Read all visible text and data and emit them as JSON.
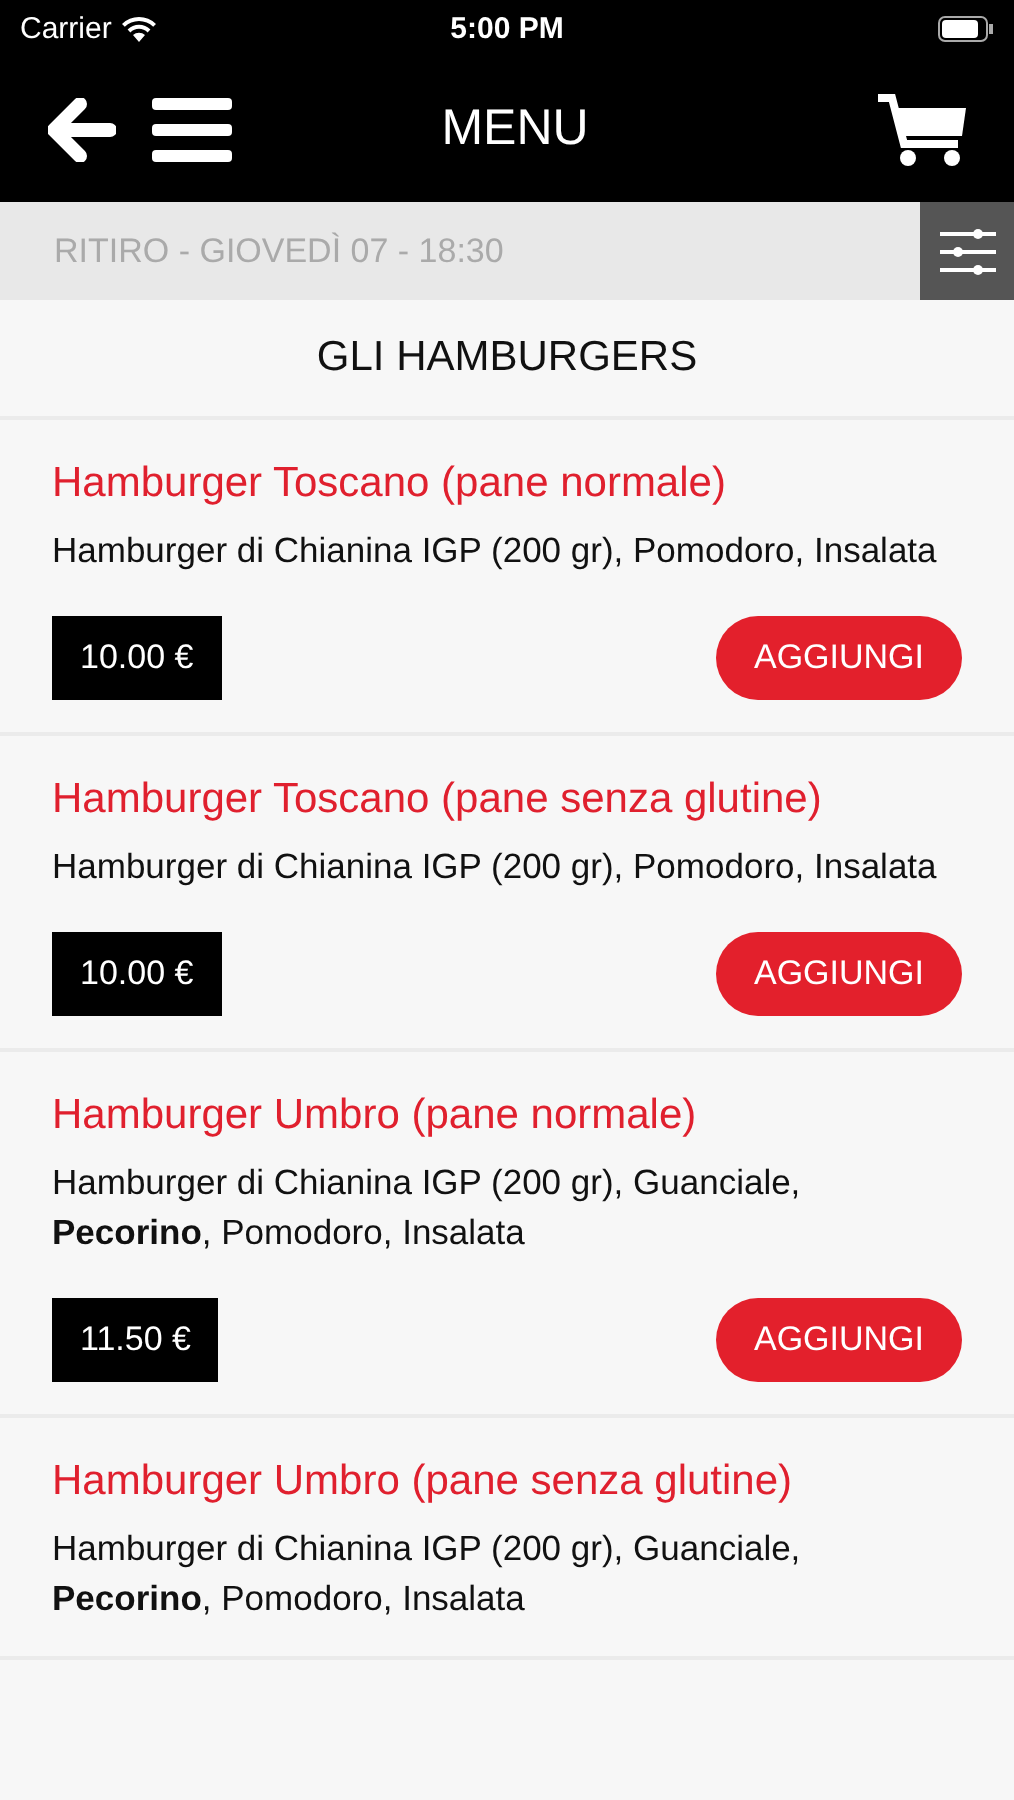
{
  "status_bar": {
    "carrier": "Carrier",
    "time": "5:00 PM"
  },
  "header": {
    "title": "MENU"
  },
  "pickup_bar": {
    "text": "RITIRO - GIOVEDÌ 07 - 18:30"
  },
  "section": {
    "title": "GLI HAMBURGERS"
  },
  "items": [
    {
      "name": "Hamburger Toscano (pane normale)",
      "description": "Hamburger di Chianina IGP (200 gr), Pomodoro, Insalata",
      "price": "10.00 €",
      "button": "AGGIUNGI"
    },
    {
      "name": "Hamburger Toscano (pane senza glutine)",
      "description": "Hamburger di Chianina IGP (200 gr), Pomodoro, Insalata",
      "price": "10.00 €",
      "button": "AGGIUNGI"
    },
    {
      "name": "Hamburger Umbro (pane normale)",
      "description": "Hamburger di Chianina IGP (200 gr), Guanciale, **Pecorino**, Pomodoro, Insalata",
      "price": "11.50 €",
      "button": "AGGIUNGI"
    },
    {
      "name": "Hamburger Umbro (pane senza glutine)",
      "description": "Hamburger di Chianina IGP (200 gr), Guanciale, **Pecorino**, Pomodoro, Insalata"
    }
  ]
}
